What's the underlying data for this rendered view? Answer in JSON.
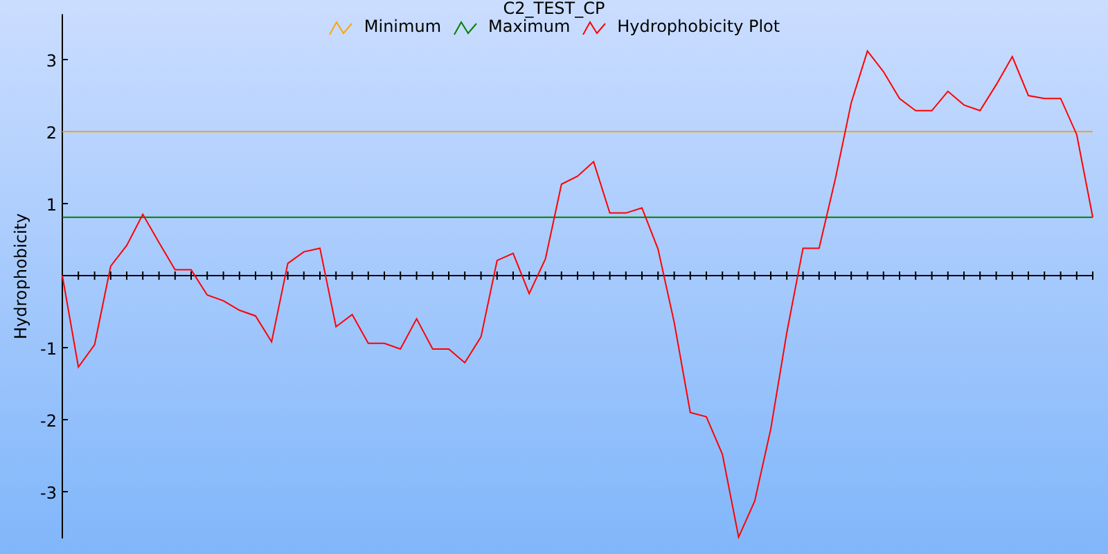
{
  "chart": {
    "chart_data": {
      "type": "line",
      "title": "C2_TEST_CP",
      "ylabel": "Hydrophobicity",
      "ylim": [
        -3.65,
        3.63
      ],
      "yticks": [
        -3,
        -2,
        -1,
        1,
        2,
        3
      ],
      "categories": [
        null,
        null,
        null,
        null,
        null,
        null,
        null,
        null,
        null,
        null,
        null,
        null,
        null,
        null,
        null,
        null,
        null,
        null,
        null,
        null,
        null,
        null,
        null,
        null,
        null,
        null,
        null,
        null,
        null,
        null,
        null,
        null,
        null,
        null,
        null,
        null,
        null,
        null,
        null,
        null,
        null,
        null,
        null,
        null,
        null,
        null,
        null,
        null,
        null,
        null,
        null,
        null,
        null,
        null,
        null,
        null,
        null,
        null,
        null,
        null,
        null,
        null,
        null,
        null,
        null
      ],
      "series": [
        {
          "name": "Minimum",
          "color": "#ffa500",
          "values": [
            2,
            2,
            2,
            2,
            2,
            2,
            2,
            2,
            2,
            2,
            2,
            2,
            2,
            2,
            2,
            2,
            2,
            2,
            2,
            2,
            2,
            2,
            2,
            2,
            2,
            2,
            2,
            2,
            2,
            2,
            2,
            2,
            2,
            2,
            2,
            2,
            2,
            2,
            2,
            2,
            2,
            2,
            2,
            2,
            2,
            2,
            2,
            2,
            2,
            2,
            2,
            2,
            2,
            2,
            2,
            2,
            2,
            2,
            2,
            2,
            2,
            2,
            2,
            2,
            2
          ]
        },
        {
          "name": "Maximum",
          "color": "#008000",
          "values": [
            0.81,
            0.81,
            0.81,
            0.81,
            0.81,
            0.81,
            0.81,
            0.81,
            0.81,
            0.81,
            0.81,
            0.81,
            0.81,
            0.81,
            0.81,
            0.81,
            0.81,
            0.81,
            0.81,
            0.81,
            0.81,
            0.81,
            0.81,
            0.81,
            0.81,
            0.81,
            0.81,
            0.81,
            0.81,
            0.81,
            0.81,
            0.81,
            0.81,
            0.81,
            0.81,
            0.81,
            0.81,
            0.81,
            0.81,
            0.81,
            0.81,
            0.81,
            0.81,
            0.81,
            0.81,
            0.81,
            0.81,
            0.81,
            0.81,
            0.81,
            0.81,
            0.81,
            0.81,
            0.81,
            0.81,
            0.81,
            0.81,
            0.81,
            0.81,
            0.81,
            0.81,
            0.81,
            0.81,
            0.81,
            0.81
          ]
        },
        {
          "name": "Hydrophobicity Plot",
          "color": "#ff0000",
          "values": [
            0,
            -1.27,
            -0.96,
            0.13,
            0.42,
            0.85,
            0.46,
            0.08,
            0.08,
            -0.27,
            -0.35,
            -0.48,
            -0.56,
            -0.92,
            0.17,
            0.33,
            0.38,
            -0.71,
            -0.54,
            -0.94,
            -0.94,
            -1.02,
            -0.6,
            -1.02,
            -1.02,
            -1.21,
            -0.85,
            0.21,
            0.31,
            -0.25,
            0.23,
            1.27,
            1.38,
            1.58,
            0.87,
            0.87,
            0.94,
            0.37,
            -0.65,
            -1.9,
            -1.96,
            -2.48,
            -3.63,
            -3.13,
            -2.13,
            -0.79,
            0.38,
            0.38,
            1.33,
            2.4,
            3.12,
            2.83,
            2.46,
            2.29,
            2.29,
            2.56,
            2.37,
            2.29,
            2.65,
            3.04,
            2.5,
            2.46,
            2.46,
            1.96,
            0.81
          ]
        }
      ]
    }
  }
}
